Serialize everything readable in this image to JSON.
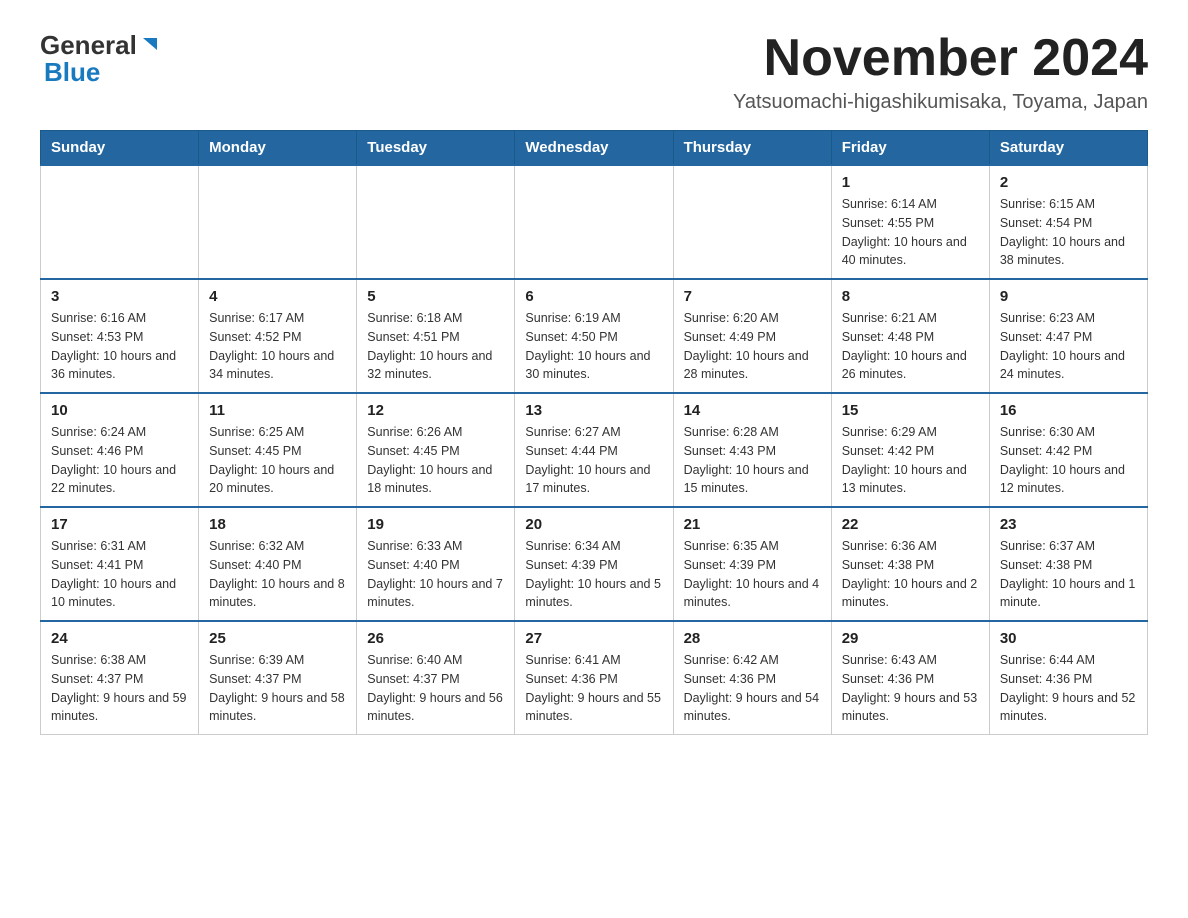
{
  "header": {
    "logo_general": "General",
    "logo_blue": "Blue",
    "month_year": "November 2024",
    "location": "Yatsuomachi-higashikumisaka, Toyama, Japan"
  },
  "days_of_week": [
    "Sunday",
    "Monday",
    "Tuesday",
    "Wednesday",
    "Thursday",
    "Friday",
    "Saturday"
  ],
  "weeks": [
    {
      "days": [
        {
          "num": "",
          "info": ""
        },
        {
          "num": "",
          "info": ""
        },
        {
          "num": "",
          "info": ""
        },
        {
          "num": "",
          "info": ""
        },
        {
          "num": "",
          "info": ""
        },
        {
          "num": "1",
          "info": "Sunrise: 6:14 AM\nSunset: 4:55 PM\nDaylight: 10 hours and 40 minutes."
        },
        {
          "num": "2",
          "info": "Sunrise: 6:15 AM\nSunset: 4:54 PM\nDaylight: 10 hours and 38 minutes."
        }
      ]
    },
    {
      "days": [
        {
          "num": "3",
          "info": "Sunrise: 6:16 AM\nSunset: 4:53 PM\nDaylight: 10 hours and 36 minutes."
        },
        {
          "num": "4",
          "info": "Sunrise: 6:17 AM\nSunset: 4:52 PM\nDaylight: 10 hours and 34 minutes."
        },
        {
          "num": "5",
          "info": "Sunrise: 6:18 AM\nSunset: 4:51 PM\nDaylight: 10 hours and 32 minutes."
        },
        {
          "num": "6",
          "info": "Sunrise: 6:19 AM\nSunset: 4:50 PM\nDaylight: 10 hours and 30 minutes."
        },
        {
          "num": "7",
          "info": "Sunrise: 6:20 AM\nSunset: 4:49 PM\nDaylight: 10 hours and 28 minutes."
        },
        {
          "num": "8",
          "info": "Sunrise: 6:21 AM\nSunset: 4:48 PM\nDaylight: 10 hours and 26 minutes."
        },
        {
          "num": "9",
          "info": "Sunrise: 6:23 AM\nSunset: 4:47 PM\nDaylight: 10 hours and 24 minutes."
        }
      ]
    },
    {
      "days": [
        {
          "num": "10",
          "info": "Sunrise: 6:24 AM\nSunset: 4:46 PM\nDaylight: 10 hours and 22 minutes."
        },
        {
          "num": "11",
          "info": "Sunrise: 6:25 AM\nSunset: 4:45 PM\nDaylight: 10 hours and 20 minutes."
        },
        {
          "num": "12",
          "info": "Sunrise: 6:26 AM\nSunset: 4:45 PM\nDaylight: 10 hours and 18 minutes."
        },
        {
          "num": "13",
          "info": "Sunrise: 6:27 AM\nSunset: 4:44 PM\nDaylight: 10 hours and 17 minutes."
        },
        {
          "num": "14",
          "info": "Sunrise: 6:28 AM\nSunset: 4:43 PM\nDaylight: 10 hours and 15 minutes."
        },
        {
          "num": "15",
          "info": "Sunrise: 6:29 AM\nSunset: 4:42 PM\nDaylight: 10 hours and 13 minutes."
        },
        {
          "num": "16",
          "info": "Sunrise: 6:30 AM\nSunset: 4:42 PM\nDaylight: 10 hours and 12 minutes."
        }
      ]
    },
    {
      "days": [
        {
          "num": "17",
          "info": "Sunrise: 6:31 AM\nSunset: 4:41 PM\nDaylight: 10 hours and 10 minutes."
        },
        {
          "num": "18",
          "info": "Sunrise: 6:32 AM\nSunset: 4:40 PM\nDaylight: 10 hours and 8 minutes."
        },
        {
          "num": "19",
          "info": "Sunrise: 6:33 AM\nSunset: 4:40 PM\nDaylight: 10 hours and 7 minutes."
        },
        {
          "num": "20",
          "info": "Sunrise: 6:34 AM\nSunset: 4:39 PM\nDaylight: 10 hours and 5 minutes."
        },
        {
          "num": "21",
          "info": "Sunrise: 6:35 AM\nSunset: 4:39 PM\nDaylight: 10 hours and 4 minutes."
        },
        {
          "num": "22",
          "info": "Sunrise: 6:36 AM\nSunset: 4:38 PM\nDaylight: 10 hours and 2 minutes."
        },
        {
          "num": "23",
          "info": "Sunrise: 6:37 AM\nSunset: 4:38 PM\nDaylight: 10 hours and 1 minute."
        }
      ]
    },
    {
      "days": [
        {
          "num": "24",
          "info": "Sunrise: 6:38 AM\nSunset: 4:37 PM\nDaylight: 9 hours and 59 minutes."
        },
        {
          "num": "25",
          "info": "Sunrise: 6:39 AM\nSunset: 4:37 PM\nDaylight: 9 hours and 58 minutes."
        },
        {
          "num": "26",
          "info": "Sunrise: 6:40 AM\nSunset: 4:37 PM\nDaylight: 9 hours and 56 minutes."
        },
        {
          "num": "27",
          "info": "Sunrise: 6:41 AM\nSunset: 4:36 PM\nDaylight: 9 hours and 55 minutes."
        },
        {
          "num": "28",
          "info": "Sunrise: 6:42 AM\nSunset: 4:36 PM\nDaylight: 9 hours and 54 minutes."
        },
        {
          "num": "29",
          "info": "Sunrise: 6:43 AM\nSunset: 4:36 PM\nDaylight: 9 hours and 53 minutes."
        },
        {
          "num": "30",
          "info": "Sunrise: 6:44 AM\nSunset: 4:36 PM\nDaylight: 9 hours and 52 minutes."
        }
      ]
    }
  ]
}
